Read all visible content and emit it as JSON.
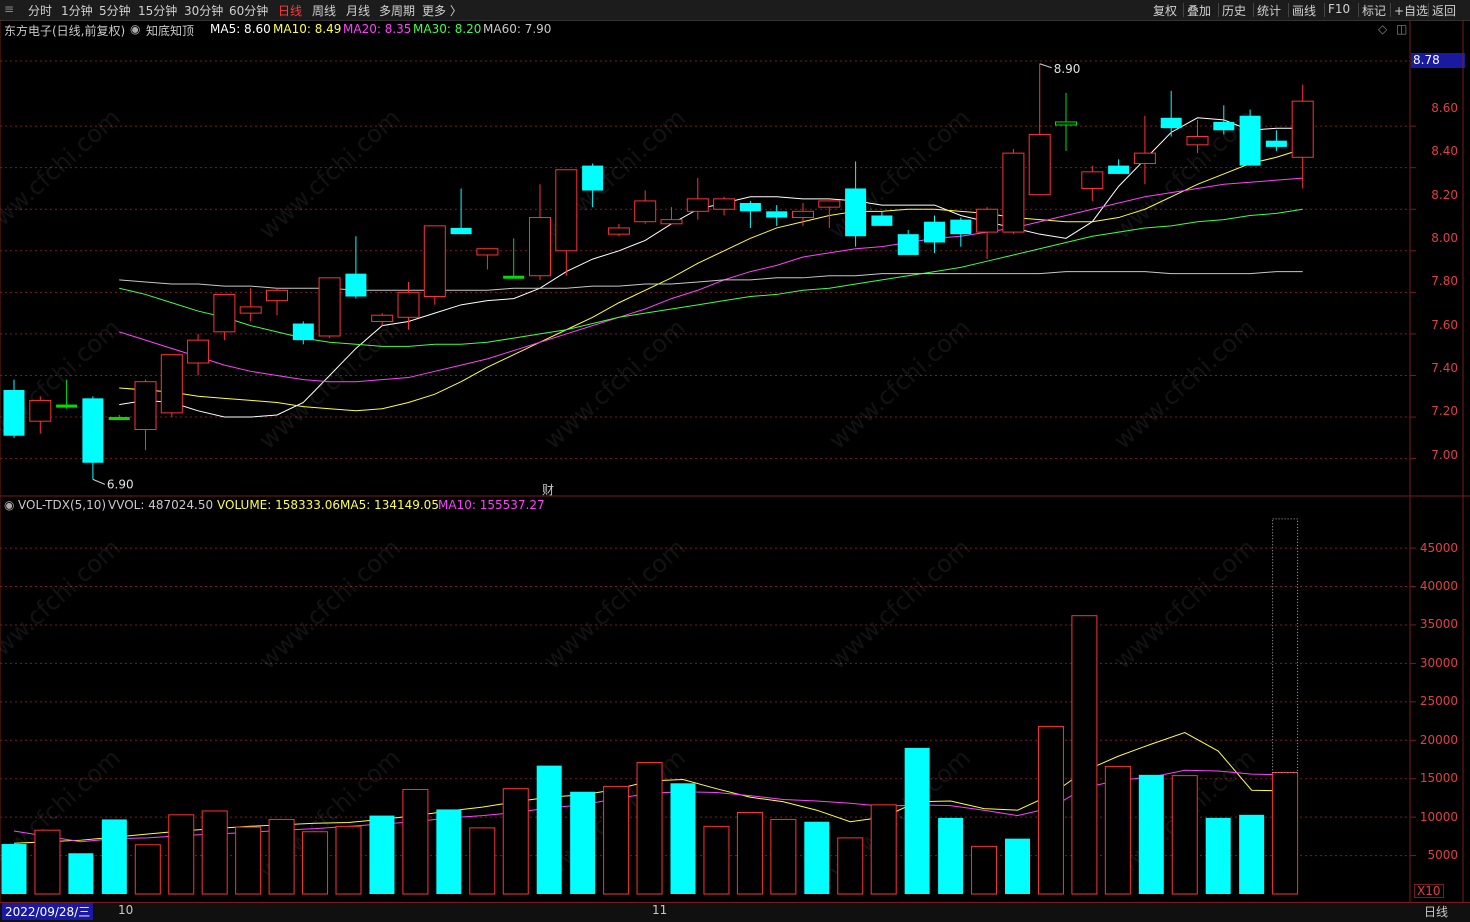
{
  "toolbar": {
    "menu_icon": "≡",
    "periods": [
      "分时",
      "1分钟",
      "5分钟",
      "15分钟",
      "30分钟",
      "60分钟",
      "日线",
      "周线",
      "月线",
      "多周期",
      "更多 〉"
    ],
    "active_period": "日线",
    "right_items": [
      "复权",
      "叠加",
      "历史",
      "统计",
      "画线",
      "F10",
      "标记",
      "+自选",
      "返回"
    ]
  },
  "kline_header": {
    "stock": "东方电子(日线,前复权)",
    "indicator_name": "知底知顶",
    "ma": [
      {
        "label": "MA5: 8.60",
        "color": "#ffffff"
      },
      {
        "label": "MA10: 8.49",
        "color": "#ffff40"
      },
      {
        "label": "MA20: 8.35",
        "color": "#ff40ff"
      },
      {
        "label": "MA30: 8.20",
        "color": "#40ff40"
      },
      {
        "label": "MA60: 7.90",
        "color": "#c8c8c8"
      }
    ]
  },
  "vol_header": {
    "name": "VOL-TDX(5,10)",
    "vvol": "VVOL: 487024.50",
    "volume": "VOLUME: 158333.06",
    "ma5": "MA5: 134149.05",
    "ma10": "MA10: 155537.27"
  },
  "price_axis": [
    "8.60",
    "8.40",
    "8.20",
    "8.00",
    "7.80",
    "7.60",
    "7.40",
    "7.20",
    "7.00"
  ],
  "current_price_label": "8.78",
  "volume_axis": [
    "45000",
    "40000",
    "35000",
    "30000",
    "25000",
    "20000",
    "15000",
    "10000",
    "5000"
  ],
  "volume_unit": "X10",
  "annotations": {
    "high": "8.90",
    "low": "6.90",
    "event_marker": "财"
  },
  "date_axis": {
    "start": "2022/09/28/三",
    "month_labels": [
      "10",
      "11"
    ]
  },
  "period_label": "日线",
  "watermark": "www.cfchi.com",
  "colors": {
    "up": "#ff3232",
    "down": "#00ffff",
    "flat_green": "#00e000",
    "bg": "#000000",
    "grid": "#7a1c1c"
  },
  "chart_data": [
    {
      "type": "candlestick",
      "title": "东方电子(日线,前复权)",
      "ylim": [
        6.82,
        9.0
      ],
      "candles": [
        {
          "o": 7.33,
          "h": 7.38,
          "l": 7.1,
          "c": 7.11
        },
        {
          "o": 7.18,
          "h": 7.3,
          "l": 7.12,
          "c": 7.28
        },
        {
          "o": 7.26,
          "h": 7.38,
          "l": 7.24,
          "c": 7.26
        },
        {
          "o": 7.29,
          "h": 7.3,
          "l": 6.9,
          "c": 6.98
        },
        {
          "o": 7.2,
          "h": 7.21,
          "l": 7.19,
          "c": 7.2
        },
        {
          "o": 7.14,
          "h": 7.38,
          "l": 7.04,
          "c": 7.37
        },
        {
          "o": 7.22,
          "h": 7.5,
          "l": 7.2,
          "c": 7.5
        },
        {
          "o": 7.46,
          "h": 7.6,
          "l": 7.4,
          "c": 7.57
        },
        {
          "o": 7.61,
          "h": 7.78,
          "l": 7.57,
          "c": 7.79
        },
        {
          "o": 7.7,
          "h": 7.82,
          "l": 7.66,
          "c": 7.73
        },
        {
          "o": 7.76,
          "h": 7.82,
          "l": 7.69,
          "c": 7.81
        },
        {
          "o": 7.65,
          "h": 7.66,
          "l": 7.55,
          "c": 7.57
        },
        {
          "o": 7.59,
          "h": 7.85,
          "l": 7.58,
          "c": 7.87
        },
        {
          "o": 7.89,
          "h": 8.07,
          "l": 7.77,
          "c": 7.78
        },
        {
          "o": 7.66,
          "h": 7.7,
          "l": 7.64,
          "c": 7.69
        },
        {
          "o": 7.68,
          "h": 7.85,
          "l": 7.62,
          "c": 7.8
        },
        {
          "o": 7.78,
          "h": 8.12,
          "l": 7.74,
          "c": 8.12
        },
        {
          "o": 8.11,
          "h": 8.3,
          "l": 8.09,
          "c": 8.08
        },
        {
          "o": 7.98,
          "h": 8.01,
          "l": 7.91,
          "c": 8.01
        },
        {
          "o": 7.88,
          "h": 8.06,
          "l": 7.88,
          "c": 7.88
        },
        {
          "o": 7.88,
          "h": 8.32,
          "l": 7.86,
          "c": 8.16
        },
        {
          "o": 8.0,
          "h": 8.38,
          "l": 7.88,
          "c": 8.39
        },
        {
          "o": 8.41,
          "h": 8.42,
          "l": 8.21,
          "c": 8.29
        },
        {
          "o": 8.08,
          "h": 8.13,
          "l": 8.07,
          "c": 8.11
        },
        {
          "o": 8.14,
          "h": 8.29,
          "l": 8.13,
          "c": 8.24
        },
        {
          "o": 8.13,
          "h": 8.21,
          "l": 8.14,
          "c": 8.15
        },
        {
          "o": 8.19,
          "h": 8.35,
          "l": 8.15,
          "c": 8.25
        },
        {
          "o": 8.2,
          "h": 8.26,
          "l": 8.17,
          "c": 8.25
        },
        {
          "o": 8.23,
          "h": 8.24,
          "l": 8.11,
          "c": 8.19
        },
        {
          "o": 8.19,
          "h": 8.22,
          "l": 8.12,
          "c": 8.16
        },
        {
          "o": 8.16,
          "h": 8.23,
          "l": 8.12,
          "c": 8.19
        },
        {
          "o": 8.21,
          "h": 8.23,
          "l": 8.11,
          "c": 8.24
        },
        {
          "o": 8.3,
          "h": 8.43,
          "l": 8.02,
          "c": 8.07
        },
        {
          "o": 8.17,
          "h": 8.19,
          "l": 8.14,
          "c": 8.12
        },
        {
          "o": 8.08,
          "h": 8.1,
          "l": 7.98,
          "c": 7.98
        },
        {
          "o": 8.14,
          "h": 8.17,
          "l": 7.99,
          "c": 8.04
        },
        {
          "o": 8.15,
          "h": 8.16,
          "l": 8.02,
          "c": 8.08
        },
        {
          "o": 8.09,
          "h": 8.21,
          "l": 7.96,
          "c": 8.2
        },
        {
          "o": 8.09,
          "h": 8.49,
          "l": 8.08,
          "c": 8.47
        },
        {
          "o": 8.27,
          "h": 8.9,
          "l": 8.42,
          "c": 8.56
        },
        {
          "o": 8.61,
          "h": 8.76,
          "l": 8.48,
          "c": 8.62
        },
        {
          "o": 8.3,
          "h": 8.41,
          "l": 8.24,
          "c": 8.38
        },
        {
          "o": 8.41,
          "h": 8.44,
          "l": 8.37,
          "c": 8.37
        },
        {
          "o": 8.42,
          "h": 8.65,
          "l": 8.32,
          "c": 8.47
        },
        {
          "o": 8.64,
          "h": 8.77,
          "l": 8.55,
          "c": 8.59
        },
        {
          "o": 8.51,
          "h": 8.63,
          "l": 8.47,
          "c": 8.55
        },
        {
          "o": 8.62,
          "h": 8.7,
          "l": 8.56,
          "c": 8.58
        },
        {
          "o": 8.65,
          "h": 8.68,
          "l": 8.41,
          "c": 8.41
        },
        {
          "o": 8.53,
          "h": 8.58,
          "l": 8.48,
          "c": 8.5
        },
        {
          "o": 8.45,
          "h": 8.8,
          "l": 8.3,
          "c": 8.72
        }
      ],
      "overlays": [
        {
          "name": "MA5",
          "color": "#ffffff",
          "values": [
            7.26,
            7.28,
            7.27,
            7.23,
            7.2,
            7.2,
            7.21,
            7.27,
            7.4,
            7.53,
            7.64,
            7.66,
            7.7,
            7.74,
            7.76,
            7.77,
            7.82,
            7.9,
            7.96,
            8.0,
            8.05,
            8.13,
            8.2,
            8.23,
            8.26,
            8.26,
            8.25,
            8.25,
            8.24,
            8.22,
            8.22,
            8.22,
            8.17,
            8.14,
            8.11,
            8.08,
            8.06,
            8.14,
            8.31,
            8.44,
            8.57,
            8.64,
            8.63,
            8.58,
            8.59,
            8.59
          ]
        },
        {
          "name": "MA10",
          "color": "#ffff40",
          "values": [
            7.34,
            7.33,
            7.32,
            7.3,
            7.29,
            7.28,
            7.27,
            7.25,
            7.24,
            7.23,
            7.24,
            7.27,
            7.31,
            7.37,
            7.44,
            7.5,
            7.56,
            7.62,
            7.68,
            7.75,
            7.81,
            7.87,
            7.94,
            8.0,
            8.06,
            8.11,
            8.14,
            8.17,
            8.19,
            8.19,
            8.2,
            8.2,
            8.19,
            8.18,
            8.16,
            8.15,
            8.14,
            8.14,
            8.16,
            8.2,
            8.26,
            8.32,
            8.37,
            8.42,
            8.45,
            8.49
          ]
        },
        {
          "name": "MA20",
          "color": "#ff40ff",
          "values": [
            7.61,
            7.57,
            7.53,
            7.49,
            7.45,
            7.42,
            7.4,
            7.38,
            7.37,
            7.37,
            7.38,
            7.39,
            7.42,
            7.45,
            7.48,
            7.52,
            7.56,
            7.6,
            7.64,
            7.68,
            7.72,
            7.77,
            7.81,
            7.86,
            7.9,
            7.93,
            7.97,
            7.99,
            8.01,
            8.02,
            8.04,
            8.06,
            8.07,
            8.09,
            8.11,
            8.14,
            8.17,
            8.2,
            8.23,
            8.26,
            8.28,
            8.3,
            8.32,
            8.33,
            8.34,
            8.35
          ]
        },
        {
          "name": "MA30",
          "color": "#40ff40",
          "values": [
            7.82,
            7.79,
            7.75,
            7.71,
            7.68,
            7.64,
            7.61,
            7.58,
            7.56,
            7.55,
            7.54,
            7.54,
            7.55,
            7.55,
            7.56,
            7.58,
            7.6,
            7.62,
            7.65,
            7.68,
            7.7,
            7.72,
            7.74,
            7.76,
            7.78,
            7.79,
            7.81,
            7.82,
            7.84,
            7.86,
            7.88,
            7.9,
            7.92,
            7.95,
            7.98,
            8.01,
            8.04,
            8.07,
            8.09,
            8.11,
            8.12,
            8.14,
            8.15,
            8.17,
            8.18,
            8.2
          ]
        },
        {
          "name": "MA60",
          "color": "#c8c8c8",
          "values": [
            7.86,
            7.85,
            7.84,
            7.84,
            7.83,
            7.83,
            7.82,
            7.82,
            7.82,
            7.81,
            7.81,
            7.81,
            7.81,
            7.81,
            7.81,
            7.82,
            7.82,
            7.82,
            7.83,
            7.83,
            7.84,
            7.84,
            7.85,
            7.86,
            7.86,
            7.87,
            7.87,
            7.88,
            7.88,
            7.89,
            7.89,
            7.89,
            7.89,
            7.89,
            7.89,
            7.89,
            7.9,
            7.9,
            7.9,
            7.9,
            7.89,
            7.89,
            7.89,
            7.89,
            7.9,
            7.9
          ]
        }
      ]
    },
    {
      "type": "bar",
      "title": "VOL-TDX(5,10)",
      "ylim": [
        0,
        48000
      ],
      "values": [
        6500,
        8300,
        5300,
        9700,
        6400,
        10300,
        10800,
        8700,
        9700,
        8100,
        8800,
        10200,
        13600,
        11000,
        8600,
        13700,
        16700,
        13300,
        14000,
        17100,
        14400,
        8800,
        10600,
        9700,
        9400,
        7300,
        11600,
        19000,
        9900,
        6200,
        7200,
        21800,
        36200,
        16600,
        15500,
        15400,
        9900,
        10300,
        15800
      ],
      "up": [
        false,
        true,
        false,
        false,
        true,
        true,
        true,
        true,
        true,
        true,
        true,
        false,
        true,
        false,
        true,
        true,
        false,
        false,
        true,
        true,
        false,
        true,
        true,
        true,
        false,
        true,
        true,
        false,
        false,
        true,
        false,
        true,
        true,
        true,
        false,
        true,
        false,
        false,
        true
      ],
      "pending_bar": 48800,
      "overlays": [
        {
          "name": "MA5",
          "color": "#ffff40",
          "values": [
            6600,
            6800,
            7000,
            7400,
            7800,
            8200,
            8500,
            8800,
            9000,
            9200,
            9300,
            9700,
            10200,
            10800,
            11300,
            12000,
            12600,
            12900,
            13600,
            14700,
            14900,
            13700,
            12600,
            12000,
            10900,
            9400,
            10000,
            12000,
            12100,
            11100,
            10900,
            12900,
            16000,
            17900,
            19500,
            21000,
            18600,
            13500,
            13400
          ]
        },
        {
          "name": "MA10",
          "color": "#ff40ff",
          "values": [
            8200,
            7500,
            6800,
            7200,
            7300,
            7600,
            7800,
            8000,
            8300,
            8500,
            8800,
            9100,
            9400,
            9900,
            10200,
            10600,
            11200,
            11600,
            12400,
            13100,
            13300,
            13200,
            12800,
            12300,
            12100,
            11800,
            11400,
            11600,
            11500,
            10900,
            10200,
            11200,
            13800,
            14800,
            15200,
            16100,
            16000,
            15600,
            15500
          ]
        }
      ]
    }
  ]
}
